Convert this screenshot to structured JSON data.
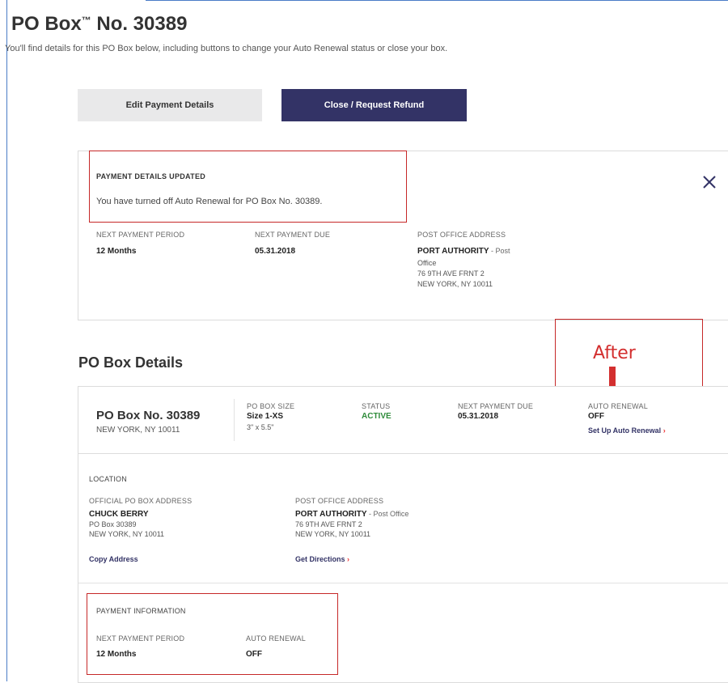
{
  "header": {
    "title_main": "PO Box",
    "title_tm": "™",
    "title_rest": " No. 30389",
    "subtitle": "You'll find details for this PO Box below, including buttons to change your Auto Renewal status or close your box."
  },
  "actions": {
    "edit_label": "Edit Payment Details",
    "close_label": "Close / Request Refund"
  },
  "notice": {
    "title": "PAYMENT DETAILS UPDATED",
    "message": "You have turned off Auto Renewal for PO Box No. 30389.",
    "close_icon": "close-icon",
    "next_period_label": "NEXT PAYMENT PERIOD",
    "next_period_value": "12 Months",
    "next_due_label": "NEXT PAYMENT DUE",
    "next_due_value": "05.31.2018",
    "po_address_label": "POST OFFICE ADDRESS",
    "po_name": "PORT AUTHORITY",
    "po_name_suffix": " - Post",
    "po_line1": "Office",
    "po_line2": "76 9TH AVE FRNT 2",
    "po_line3": "NEW YORK, NY 10011"
  },
  "details": {
    "section_title": "PO Box Details",
    "annotation": "After",
    "box_title": "PO Box No. 30389",
    "box_city": "NEW YORK, NY 10011",
    "size_label": "PO BOX SIZE",
    "size_value": "Size 1-XS",
    "size_dims": "3\" x 5.5\"",
    "status_label": "STATUS",
    "status_value": "ACTIVE",
    "due_label": "NEXT PAYMENT DUE",
    "due_value": "05.31.2018",
    "renewal_label": "AUTO RENEWAL",
    "renewal_value": "OFF",
    "renewal_link": "Set Up Auto Renewal",
    "status_color": "#2e8b3a"
  },
  "location": {
    "heading": "LOCATION",
    "official_label": "OFFICIAL PO BOX ADDRESS",
    "official_name": "CHUCK BERRY",
    "official_line1": "PO Box 30389",
    "official_line2": "NEW YORK, NY 10011",
    "copy_link": "Copy Address",
    "po_label": "POST OFFICE ADDRESS",
    "po_name": "PORT AUTHORITY",
    "po_name_suffix": " - Post Office",
    "po_line1": "76 9TH AVE FRNT 2",
    "po_line2": "NEW YORK, NY 10011",
    "directions_link": "Get Directions"
  },
  "payment": {
    "heading": "PAYMENT INFORMATION",
    "period_label": "NEXT PAYMENT PERIOD",
    "period_value": "12 Months",
    "renewal_label": "AUTO RENEWAL",
    "renewal_value": "OFF"
  },
  "colors": {
    "brand_navy": "#333366",
    "annotation_red": "#d32f2f",
    "link_chevron": "#e33333"
  }
}
